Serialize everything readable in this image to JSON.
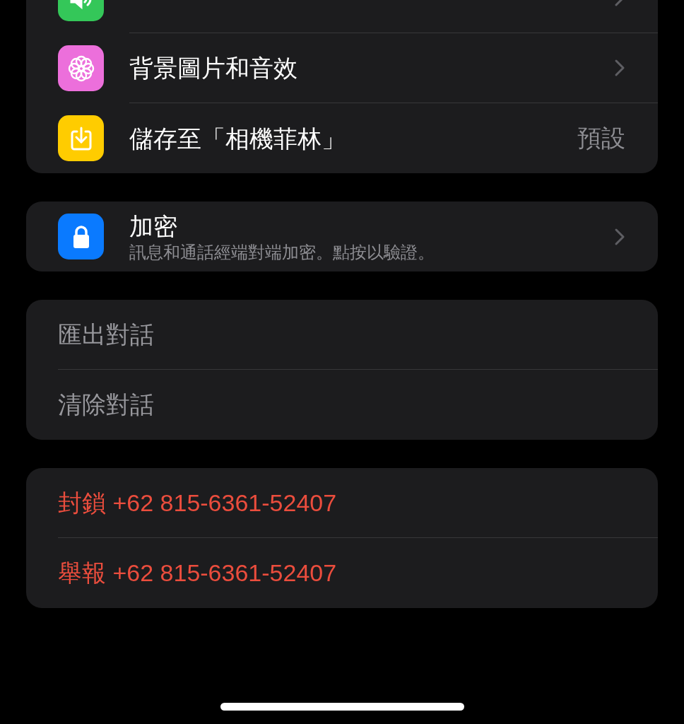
{
  "sections": [
    {
      "rows": [
        {
          "kind": "setting",
          "chevron": true,
          "color": "#34c759"
        },
        {
          "kind": "setting",
          "label": "背景圖片和音效",
          "chevron": true,
          "color": "#ec6fdb"
        },
        {
          "kind": "setting",
          "label": "儲存至「相機菲林」",
          "value": "預設",
          "chevron": false,
          "color": "#ffcc00"
        }
      ]
    },
    {
      "rows": [
        {
          "kind": "setting",
          "label": "加密",
          "subtitle": "訊息和通話經端對端加密。點按以驗證。",
          "chevron": true,
          "color": "#0a7aff"
        }
      ]
    },
    {
      "rows": [
        {
          "kind": "action",
          "label": "匯出對話",
          "destructive": false,
          "disabled": true
        },
        {
          "kind": "action",
          "label": "清除對話",
          "destructive": false,
          "disabled": true
        }
      ]
    },
    {
      "rows": [
        {
          "kind": "action",
          "label": "封鎖 +62 815-6361-52407",
          "destructive": true,
          "disabled": false
        },
        {
          "kind": "action",
          "label": "舉報 +62 815-6361-52407",
          "destructive": true,
          "disabled": false
        }
      ]
    }
  ]
}
